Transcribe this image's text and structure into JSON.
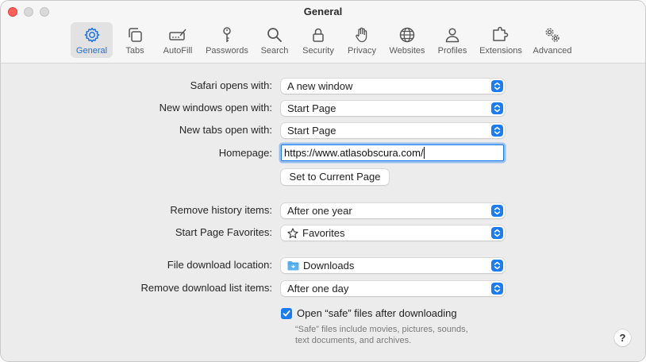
{
  "window": {
    "title": "General"
  },
  "toolbar": {
    "items": [
      {
        "label": "General",
        "icon": "gear-icon",
        "active": true
      },
      {
        "label": "Tabs",
        "icon": "tabs-icon"
      },
      {
        "label": "AutoFill",
        "icon": "autofill-icon"
      },
      {
        "label": "Passwords",
        "icon": "key-icon"
      },
      {
        "label": "Search",
        "icon": "search-icon"
      },
      {
        "label": "Security",
        "icon": "lock-icon"
      },
      {
        "label": "Privacy",
        "icon": "hand-icon"
      },
      {
        "label": "Websites",
        "icon": "globe-icon"
      },
      {
        "label": "Profiles",
        "icon": "person-icon"
      },
      {
        "label": "Extensions",
        "icon": "puzzle-icon"
      },
      {
        "label": "Advanced",
        "icon": "gears-icon"
      }
    ]
  },
  "settings": {
    "safari_opens_with": {
      "label": "Safari opens with:",
      "value": "A new window"
    },
    "new_windows": {
      "label": "New windows open with:",
      "value": "Start Page"
    },
    "new_tabs": {
      "label": "New tabs open with:",
      "value": "Start Page"
    },
    "homepage": {
      "label": "Homepage:",
      "value": "https://www.atlasobscura.com/"
    },
    "set_current_page": "Set to Current Page",
    "remove_history": {
      "label": "Remove history items:",
      "value": "After one year"
    },
    "start_page_favorites": {
      "label": "Start Page Favorites:",
      "value": "Favorites",
      "icon": "star-icon"
    },
    "download_location": {
      "label": "File download location:",
      "value": "Downloads",
      "icon": "folder-icon"
    },
    "remove_download_items": {
      "label": "Remove download list items:",
      "value": "After one day"
    },
    "open_safe_files": {
      "label": "Open “safe” files after downloading",
      "checked": true
    },
    "safe_files_hint_line1": "“Safe” files include movies, pictures, sounds,",
    "safe_files_hint_line2": "text documents, and archives."
  },
  "help": {
    "label": "?"
  },
  "colors": {
    "accent": "#1a7cf5"
  }
}
